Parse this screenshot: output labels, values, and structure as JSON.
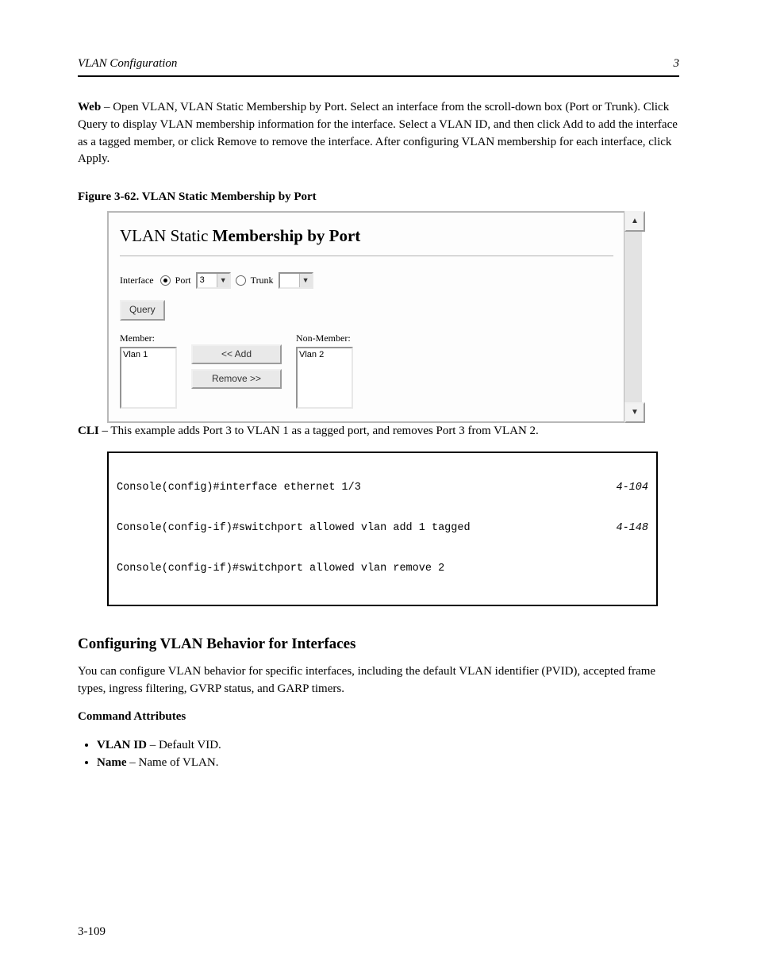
{
  "header": {
    "left": "VLAN Configuration",
    "right": "3",
    "page_number": "3-109"
  },
  "intro": {
    "para1_prefix": "Web",
    "para1_rest": " – Open VLAN, VLAN Static Membership by Port. Select an interface from the scroll-down box (Port or Trunk). Click Query to display VLAN membership information for the interface. Select a VLAN ID, and then click Add to add the interface as a tagged member, or click Remove to remove the interface. After configuring VLAN membership for each interface, click Apply.",
    "figure_label": "Figure 3-62.   VLAN Static Membership by Port",
    "cli_label_prefix": "CLI",
    "cli_label_rest": " – This example adds Port 3 to VLAN 1 as a tagged port, and removes Port 3 from VLAN 2."
  },
  "ui": {
    "title_thin": "VLAN Static ",
    "title_bold": "Membership by Port",
    "interface_label": "Interface",
    "port_label": "Port",
    "port_value": "3",
    "trunk_label": "Trunk",
    "trunk_value": "",
    "query_btn": "Query",
    "member_label": "Member:",
    "nonmember_label": "Non-Member:",
    "member_item": "Vlan 1",
    "nonmember_item": "Vlan 2",
    "add_btn": "<< Add",
    "remove_btn": "Remove >>"
  },
  "cli": {
    "lines": [
      {
        "cmd": "Console(config)#interface ethernet 1/3",
        "ref": "4-104"
      },
      {
        "cmd": "Console(config-if)#switchport allowed vlan add 1 tagged",
        "ref": "4-148"
      },
      {
        "cmd": "Console(config-if)#switchport allowed vlan remove 2",
        "ref": ""
      }
    ]
  },
  "section": {
    "heading": "Configuring VLAN Behavior for Interfaces",
    "para": "You can configure VLAN behavior for specific interfaces, including the default VLAN identifier (PVID), accepted frame types, ingress filtering, GVRP status, and GARP timers.",
    "ca_heading": "Command Attributes",
    "bullets": [
      {
        "b": "VLAN ID",
        "rest": " – Default VID."
      },
      {
        "b": "Name",
        "rest": " – Name of VLAN."
      }
    ]
  }
}
